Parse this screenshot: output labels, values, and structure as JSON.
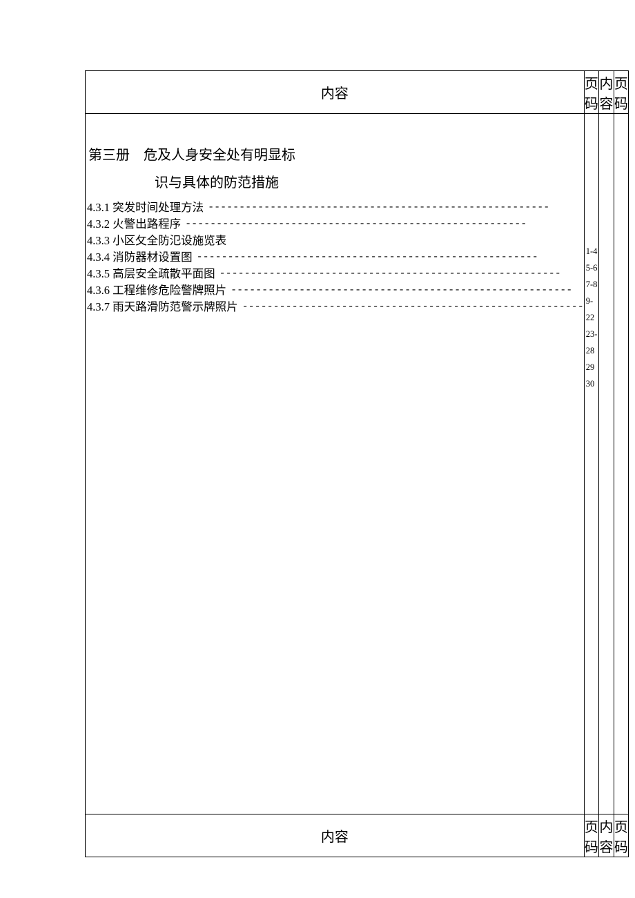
{
  "headers": {
    "content_1": "内容",
    "page_1": "页码",
    "content_2": "内容",
    "page_2": "页码"
  },
  "footers": {
    "content_1": "内容",
    "page_1": "页码",
    "content_2": "内容",
    "page_2": "页码"
  },
  "volume": {
    "prefix": "第三册",
    "title_line1": "危及人身安全处有明显标",
    "title_line2": "识与具体的防范措施"
  },
  "toc": [
    {
      "num": "4.3.1",
      "title": "突发时间处理方法",
      "page": "1-4",
      "dash": true
    },
    {
      "num": "4.3.2",
      "title": "火警出路程序",
      "page": "5-6",
      "dash": true
    },
    {
      "num": "4.3.3",
      "title": "小区攵全防氾设施览表",
      "page": "7-8",
      "dash": false
    },
    {
      "num": "4.3.4",
      "title": "消防器材设置图",
      "page": "9-22",
      "dash": true
    },
    {
      "num": "4.3.5",
      "title": "高层安全疏散平面图",
      "page": "23-28",
      "dash": true
    },
    {
      "num": "4.3.6",
      "title": "工程维修危险警牌照片",
      "page": "29",
      "dash": true
    },
    {
      "num": "4.3.7",
      "title": "雨天路滑防范警示牌照片",
      "page": "30",
      "dash": true
    }
  ]
}
